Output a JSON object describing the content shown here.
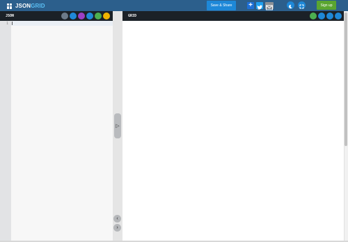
{
  "header": {
    "logo_text_primary": "JSON",
    "logo_text_accent": "GRID",
    "save_share_label": "Save & Share",
    "add_icon": "+",
    "signup_label": "Sign up",
    "colors": {
      "bar": "#2c5f8c",
      "save": "#1e88d8",
      "signup": "#5aa530"
    },
    "icons": [
      "plus-icon",
      "twitter-icon",
      "mail-icon",
      "theme-icon",
      "fullscreen-icon"
    ]
  },
  "json_panel": {
    "title": "JSON",
    "line_numbers": [
      "1"
    ],
    "tools": [
      {
        "name": "copy-icon",
        "color": "#6c7a89"
      },
      {
        "name": "search-icon",
        "color": "#1e88d8"
      },
      {
        "name": "format-icon",
        "color": "#9b3fc4"
      },
      {
        "name": "file-icon",
        "color": "#1e88d8"
      },
      {
        "name": "upload-icon",
        "color": "#4caf50"
      },
      {
        "name": "sample-icon",
        "color": "#f0b400"
      }
    ]
  },
  "divider": {
    "toggle_glyph": "▷",
    "prev_glyph": "‹",
    "next_glyph": "›"
  },
  "grid_panel": {
    "title": "GRID",
    "tools": [
      {
        "name": "filter-icon",
        "color": "#4caf50"
      },
      {
        "name": "search-icon",
        "color": "#1e88d8"
      },
      {
        "name": "expand-icon",
        "color": "#1e88d8"
      },
      {
        "name": "collapse-icon",
        "color": "#1e88d8"
      }
    ]
  }
}
